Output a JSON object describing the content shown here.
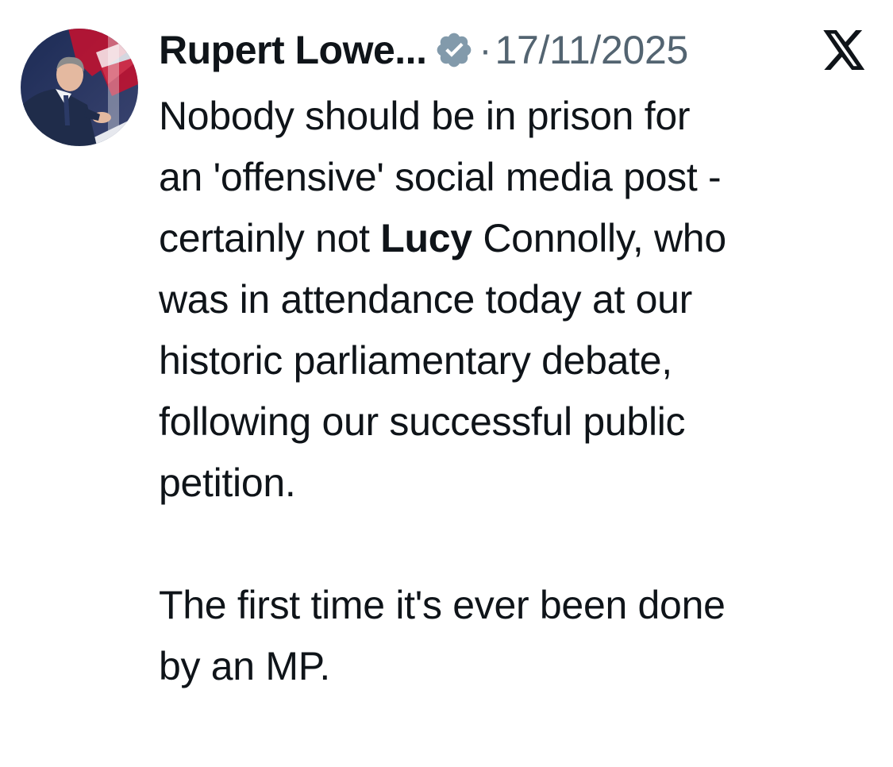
{
  "tweet": {
    "author": {
      "display_name": "Rupert Lowe...",
      "verified_icon": "verified-badge-icon",
      "avatar_icon": "avatar"
    },
    "separator": "·",
    "date": "17/11/2025",
    "platform_icon": "x-logo-icon",
    "body": {
      "line1": "Nobody should be in prison for",
      "line2": "an 'offensive' social media post -",
      "line3_pre": "certainly not ",
      "line3_bold": "Lucy",
      "line3_post": " Connolly, who",
      "line4": "was in attendance today at our",
      "line5": "historic parliamentary debate,",
      "line6": "following our successful public",
      "line7": "petition.",
      "line8": "The first time it's ever been done",
      "line9": "by an MP."
    }
  },
  "colors": {
    "text": "#0f1419",
    "muted": "#536471",
    "verified_badge": "#829aab",
    "background": "#ffffff"
  }
}
